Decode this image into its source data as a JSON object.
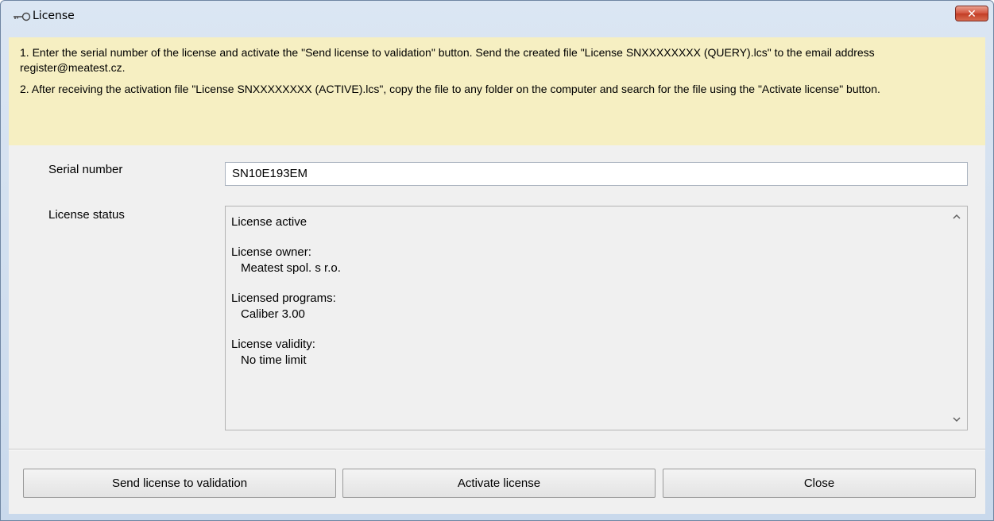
{
  "window": {
    "title": "License",
    "close_glyph": "✕"
  },
  "instructions": {
    "step1": "1. Enter the serial number of the license and activate the \"Send license to validation\" button. Send the created file \"License SNXXXXXXXX (QUERY).lcs\" to the email address register@meatest.cz.",
    "step2": "2. After receiving the activation file \"License SNXXXXXXXX (ACTIVE).lcs\", copy the file to any folder on the computer and search for the file using the \"Activate license\" button."
  },
  "form": {
    "serial_label": "Serial number",
    "serial_value": "SN10E193EM",
    "status_label": "License status"
  },
  "status": {
    "state": "License active",
    "owner_label": "License owner:",
    "owner_value": "Meatest spol. s r.o.",
    "programs_label": "Licensed programs:",
    "programs_value": "Caliber 3.00",
    "validity_label": "License validity:",
    "validity_value": "No time limit"
  },
  "buttons": {
    "send": "Send license to validation",
    "activate": "Activate license",
    "close": "Close"
  },
  "icons": {
    "title": "key-icon",
    "scroll_up": "chevron-up-icon",
    "scroll_down": "chevron-down-icon"
  },
  "colors": {
    "info_background": "#f6efc2",
    "close_button": "#c23c25"
  }
}
